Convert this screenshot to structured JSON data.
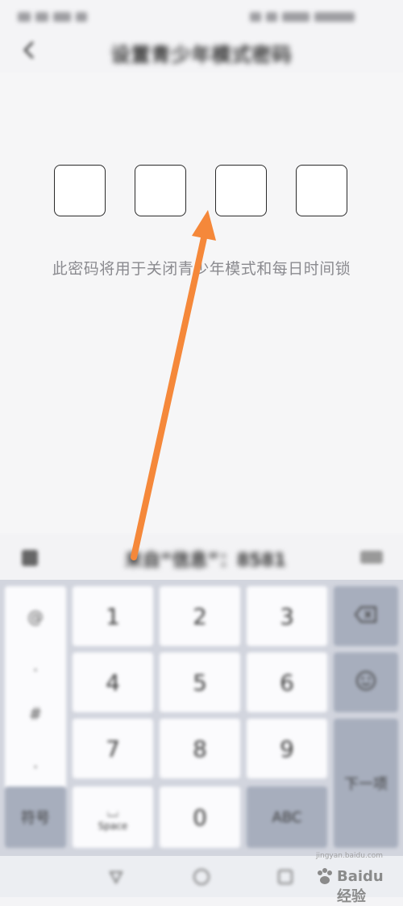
{
  "status_bar": {},
  "header": {
    "title": "设置青少年模式密码"
  },
  "pin": {
    "boxes": [
      "",
      "",
      "",
      ""
    ]
  },
  "hint": {
    "text": "此密码将用于关闭青少年模式和每日时间锁"
  },
  "candidate_bar": {
    "text": "来自“信息”：8581"
  },
  "keyboard": {
    "symbols": [
      "@",
      ".",
      "#",
      "."
    ],
    "digits": [
      "1",
      "2",
      "3",
      "4",
      "5",
      "6",
      "7",
      "8",
      "9",
      "0"
    ],
    "switch_label": "符号",
    "space_label": "Space",
    "abc_label": "ABC",
    "next_label": "下一项",
    "delete_icon": "delete-icon",
    "emoji_icon": "emoji-icon"
  },
  "annotation": {
    "arrow_color": "#f5883a"
  },
  "watermark": {
    "text": "Baidu经验",
    "sub": "jingyan.baidu.com"
  }
}
